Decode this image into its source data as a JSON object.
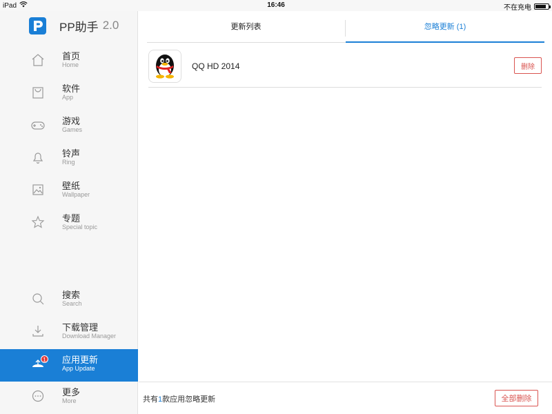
{
  "status_bar": {
    "device": "iPad",
    "time": "16:46",
    "charging_text": "不在充电",
    "battery_level": 0.85
  },
  "brand": {
    "name": "PP助手",
    "version": "2.0",
    "logo_color": "#1a7fd6"
  },
  "sidebar": {
    "items": [
      {
        "label": "首页",
        "sub": "Home",
        "icon": "home-icon"
      },
      {
        "label": "软件",
        "sub": "App",
        "icon": "app-icon"
      },
      {
        "label": "游戏",
        "sub": "Games",
        "icon": "gamepad-icon"
      },
      {
        "label": "铃声",
        "sub": "Ring",
        "icon": "bell-icon"
      },
      {
        "label": "壁纸",
        "sub": "Wallpaper",
        "icon": "image-icon"
      },
      {
        "label": "专题",
        "sub": "Special topic",
        "icon": "star-icon"
      }
    ],
    "bottom_items": [
      {
        "label": "搜索",
        "sub": "Search",
        "icon": "search-icon"
      },
      {
        "label": "下载管理",
        "sub": "Download Manager",
        "icon": "download-icon"
      },
      {
        "label": "应用更新",
        "sub": "App Update",
        "icon": "update-icon",
        "badge": "1",
        "active": true
      },
      {
        "label": "更多",
        "sub": "More",
        "icon": "more-icon"
      }
    ]
  },
  "tabs": [
    {
      "label": "更新列表",
      "active": false
    },
    {
      "label": "忽略更新 (1)",
      "active": true
    }
  ],
  "apps": [
    {
      "name": "QQ HD 2014",
      "icon": "qq-penguin-icon",
      "action": "删除"
    }
  ],
  "footer": {
    "prefix": "共有",
    "count": "1",
    "suffix": "款应用忽略更新",
    "delete_all": "全部删除"
  },
  "colors": {
    "accent": "#1a7fd6",
    "danger": "#d9534f",
    "badge": "#e23b3b"
  }
}
